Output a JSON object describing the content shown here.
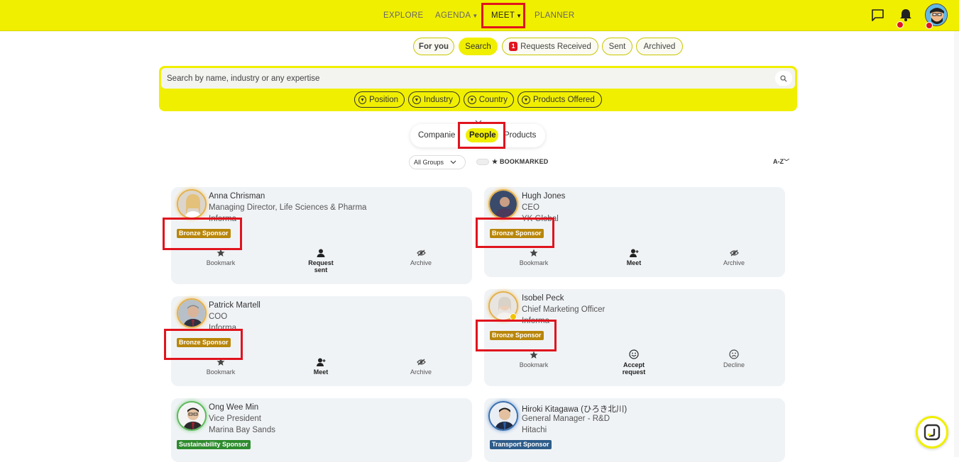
{
  "nav": {
    "explore": "EXPLORE",
    "agenda": "AGENDA",
    "meet": "MEET",
    "planner": "PLANNER"
  },
  "tabs": {
    "for_you": "For you",
    "search": "Search",
    "requests_count": "1",
    "requests": "Requests Received",
    "sent": "Sent",
    "archived": "Archived"
  },
  "search": {
    "placeholder": "Search by name, industry or any expertise"
  },
  "filters": [
    "Position",
    "Industry",
    "Country",
    "Products Offered"
  ],
  "segments": {
    "companies": "Companie",
    "people": "People",
    "products": "Products"
  },
  "controls": {
    "groups": "All Groups",
    "bookmarked": "BOOKMARKED",
    "sort": "A-Z"
  },
  "cards": [
    {
      "name": "Anna Chrisman",
      "role": "Managing Director, Life Sciences & Pharma",
      "org": "Informa",
      "sponsor": "Bronze Sponsor",
      "a1": "Bookmark",
      "a2": "Request sent",
      "a2b": "sent",
      "a2a": "Request",
      "a3": "Archive"
    },
    {
      "name": "Hugh Jones",
      "role": "CEO",
      "org": "YK Global",
      "sponsor": "Bronze Sponsor",
      "a1": "Bookmark",
      "a2": "Meet",
      "a3": "Archive"
    },
    {
      "name": "Patrick Martell",
      "role": "COO",
      "org": "Informa",
      "sponsor": "Bronze Sponsor",
      "a1": "Bookmark",
      "a2": "Meet",
      "a3": "Archive"
    },
    {
      "name": "Isobel Peck",
      "role": "Chief Marketing Officer",
      "org": "Informa",
      "sponsor": "Bronze Sponsor",
      "a1": "Bookmark",
      "a2a": "Accept",
      "a2b": "request",
      "a3": "Decline"
    },
    {
      "name": "Ong Wee Min",
      "role": "Vice President",
      "org": "Marina Bay Sands",
      "sponsor": "Sustainability Sponsor"
    },
    {
      "name": "Hiroki Kitagawa (ひろき北川)",
      "role": "General Manager - R&D",
      "org": "Hitachi",
      "sponsor": "Transport Sponsor"
    }
  ]
}
